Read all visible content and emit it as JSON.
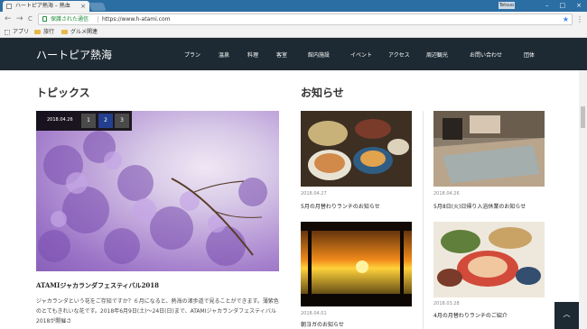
{
  "browser": {
    "tab_title": "ハートピア熱海 – 熱血",
    "tab_close": "×",
    "user_badge": "Tetsuo",
    "window_controls": [
      "–",
      "□",
      "×"
    ],
    "nav": {
      "back": "←",
      "forward": "→",
      "reload": "C"
    },
    "secure_label": "保護された通信",
    "url": "https://www.h-atami.com",
    "star": "★",
    "menu": "⋮",
    "bookmarks": [
      "アプリ",
      "旅行",
      "グルメ関連"
    ]
  },
  "site": {
    "logo": "ハートピア熱海",
    "nav": [
      "プラン",
      "温泉",
      "料理",
      "客室",
      "館内施設",
      "イベント",
      "アクセス",
      "周辺観光",
      "お問い合わせ",
      "団体"
    ]
  },
  "topics": {
    "heading": "トピックス",
    "slider": {
      "date": "2018.04.26",
      "pages": [
        "1",
        "2",
        "3"
      ],
      "active_page": "2"
    },
    "article": {
      "title": "ATAMIジャカランダフェスティバル2018",
      "body": "ジャカランダという花をご存知ですか？６月になると、熱海の渚歩道で見ることができます。薄紫色のとてもきれいな花です。2018年6月9日(土)〜24日(日)まで、ATAMIジャカランダフェスティバル2018が開催さ"
    }
  },
  "news": {
    "heading": "お知らせ",
    "items": [
      {
        "date": "2018.04.27",
        "title": "5月の月替わりランチのお知らせ"
      },
      {
        "date": "2018.04.26",
        "title": "5月8日(火)日帰り入浴休業のお知らせ"
      },
      {
        "date": "2018.04.01",
        "title": "朝ヨガのお知らせ"
      },
      {
        "date": "2018.03.28",
        "title": "4月の月替わりランチのご紹介"
      }
    ]
  },
  "pagetop": "︿",
  "colors": {
    "header_bg": "#1d2a33",
    "active_page": "#233f8f",
    "chrome_tab": "#2b6ea4"
  }
}
